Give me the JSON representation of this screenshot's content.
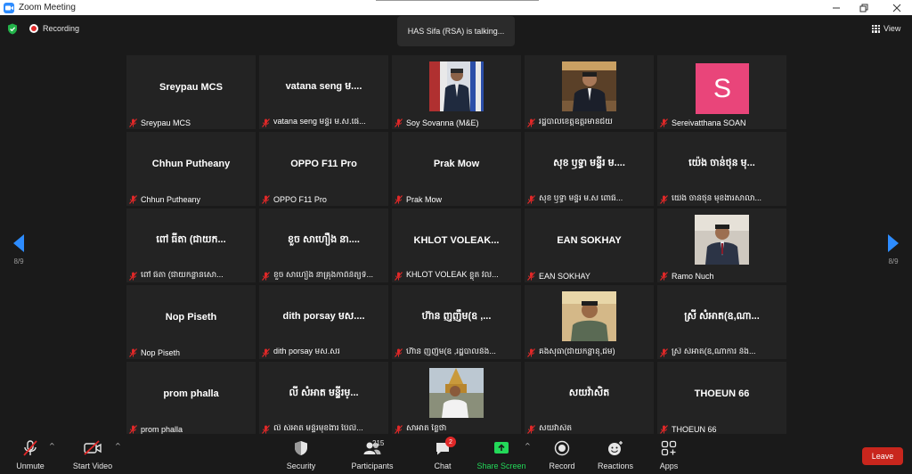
{
  "window": {
    "title": "Zoom Meeting"
  },
  "status": {
    "recording_label": "Recording",
    "talking_banner": "HAS Sifa (RSA) is talking...",
    "view_label": "View"
  },
  "pagination": {
    "left_page": "8/9",
    "right_page": "8/9"
  },
  "tiles": [
    {
      "display": "Sreypau MCS",
      "label": "Sreypau MCS",
      "type": "name"
    },
    {
      "display": "vatana seng  ម....",
      "label": "vatana seng  មន្ទីរ ម.ស.ផេ...",
      "type": "name"
    },
    {
      "display": "",
      "label": "Soy Sovanna (M&E)",
      "type": "photo"
    },
    {
      "display": "",
      "label": "រដ្ឋបាលខេត្តឧត្តរមានជ័យ",
      "type": "photo"
    },
    {
      "display": "S",
      "label": "Sereivatthana SOAN",
      "type": "avatar"
    },
    {
      "display": "Chhun Putheany",
      "label": "Chhun Putheany",
      "type": "name"
    },
    {
      "display": "OPPO F11 Pro",
      "label": "OPPO F11 Pro",
      "type": "name"
    },
    {
      "display": "Prak Mow",
      "label": "Prak Mow",
      "type": "name"
    },
    {
      "display": "សុខ ឫទ្ធា មន្ទីរ ម....",
      "label": "សុខ ឫទ្ធា មន្ទីរ ម.ស ពោធិ...",
      "type": "name"
    },
    {
      "display": "យ៉េង ចាន់ថុន មុ...",
      "label": "យ៉េង ចាន់ថុន មុខងារសាលា...",
      "type": "name"
    },
    {
      "display": "ពៅ ធីតា (ជាយក...",
      "label": "ពៅ ធីតា (ជាយកន្លានសោ...",
      "type": "name"
    },
    {
      "display": "ខួច សាហឿង នា....",
      "label": "ខួច សាហឿង នាគ្រុងកាពិនិត្យទិ...",
      "type": "name"
    },
    {
      "display": "KHLOT  VOLEAK...",
      "label": "KHLOT  VOLEAK  ខ្លុត វល័...",
      "type": "name"
    },
    {
      "display": "EAN SOKHAY",
      "label": "EAN SOKHAY",
      "type": "name"
    },
    {
      "display": "",
      "label": "Ramo Nuch",
      "type": "photo"
    },
    {
      "display": "Nop Piseth",
      "label": "Nop Piseth",
      "type": "name"
    },
    {
      "display": "dith porsay មស....",
      "label": "dith porsay មស.សរ",
      "type": "name"
    },
    {
      "display": "ហ៊ាន ញញឹម(ឧ ,...",
      "label": "ហ៊ាន ញញឹម(ឧ ,រដ្ឋបាលនិង...",
      "type": "name"
    },
    {
      "display": "",
      "label": "គង់សុធា(ជាយកន្លានុ,ជម)",
      "type": "photo"
    },
    {
      "display": "ស្រី សំអាត(ឧ,ណា...",
      "label": "ស្រី សំអាត(ឧ,ណាការ និង...",
      "type": "name"
    },
    {
      "display": "prom phalla",
      "label": "prom phalla",
      "type": "name"
    },
    {
      "display": "លី សំអាត មន្ទីរម្...",
      "label": "លី សំអាត មន្ទីរមុខងារ ប៉ៃលិ...",
      "type": "name"
    },
    {
      "display": "",
      "label": "សាអាត ខ្លៃថា",
      "type": "photo"
    },
    {
      "display": "សយវ៉ាសិត",
      "label": "សយវ៉ាសិត",
      "type": "name"
    },
    {
      "display": "THOEUN 66",
      "label": "THOEUN 66",
      "type": "name"
    }
  ],
  "toolbar": {
    "unmute": "Unmute",
    "start_video": "Start Video",
    "security": "Security",
    "participants": "Participants",
    "participants_count": "215",
    "chat": "Chat",
    "chat_badge": "2",
    "share_screen": "Share Screen",
    "record": "Record",
    "reactions": "Reactions",
    "apps": "Apps",
    "leave": "Leave"
  },
  "colors": {
    "accent": "#2d8cff",
    "share_green": "#23d959",
    "leave_red": "#c8261d",
    "mute_red": "#e02828",
    "avatar_pink": "#e9457a"
  }
}
